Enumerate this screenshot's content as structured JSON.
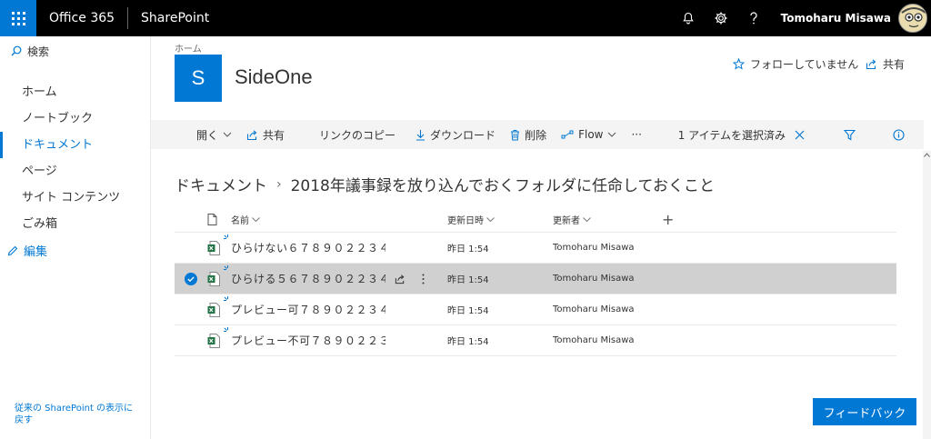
{
  "suitebar": {
    "brand": "Office 365",
    "app": "SharePoint",
    "user_name": "Tomoharu Misawa",
    "icons": [
      "bell-icon",
      "gear-icon",
      "help-icon"
    ]
  },
  "leftnav": {
    "search_label": "検索",
    "items": [
      {
        "label": "ホーム",
        "selected": false
      },
      {
        "label": "ノートブック",
        "selected": false
      },
      {
        "label": "ドキュメント",
        "selected": true
      },
      {
        "label": "ページ",
        "selected": false
      },
      {
        "label": "サイト コンテンツ",
        "selected": false
      },
      {
        "label": "ごみ箱",
        "selected": false
      }
    ],
    "edit_label": "編集",
    "classic_label": "従来の SharePoint の表示に戻す"
  },
  "site": {
    "crumb": "ホーム",
    "logo_letter": "S",
    "title": "SideOne",
    "follow_label": "フォローしていません",
    "share_label": "共有"
  },
  "cmdbar": {
    "open_label": "開く",
    "share_label": "共有",
    "copy_link_label": "リンクのコピー",
    "download_label": "ダウンロード",
    "delete_label": "削除",
    "flow_label": "Flow",
    "more_label": "···",
    "selected_label": "1 アイテムを選択済み"
  },
  "breadcrumb": {
    "root": "ドキュメント",
    "current": "2018年議事録を放り込んでおくフォルダに任命しておくこと"
  },
  "list": {
    "headers": {
      "name": "名前",
      "modified": "更新日時",
      "modified_by": "更新者",
      "add": "+"
    },
    "rows": [
      {
        "name": "ひらけない６７８９０２２３４…",
        "modified": "昨日 1:54",
        "modified_by": "Tomoharu Misawa",
        "selected": false
      },
      {
        "name": "ひらける５６７８９０２２３４…",
        "modified": "昨日 1:54",
        "modified_by": "Tomoharu Misawa",
        "selected": true
      },
      {
        "name": "プレビュー可７８９０２２３４…",
        "modified": "昨日 1:54",
        "modified_by": "Tomoharu Misawa",
        "selected": false
      },
      {
        "name": "プレビュー不可７８９０２２３…",
        "modified": "昨日 1:54",
        "modified_by": "Tomoharu Misawa",
        "selected": false
      }
    ]
  },
  "feedback_label": "フィードバック",
  "colors": {
    "accent": "#0078d4",
    "suitebar": "#000000",
    "selected_row": "#d0d0d0",
    "excel_green": "#217346"
  }
}
